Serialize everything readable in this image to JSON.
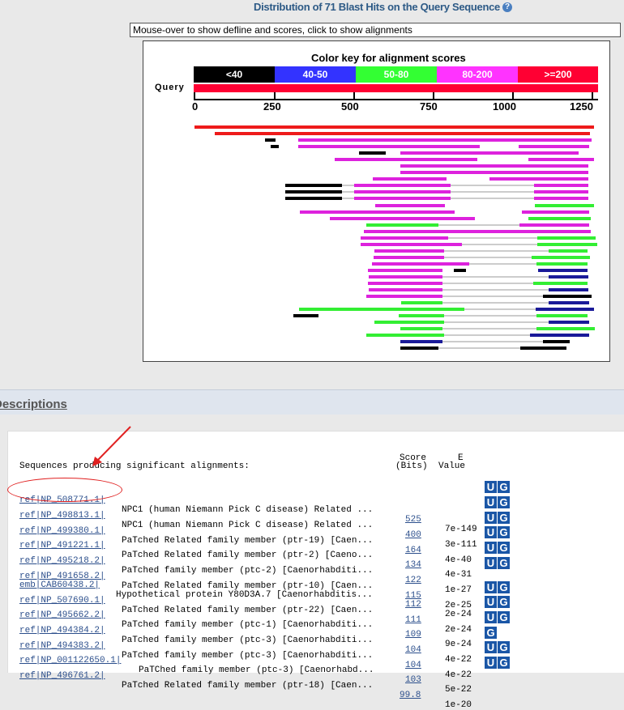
{
  "header": {
    "title": "Distribution of 71 Blast Hits on the Query Sequence",
    "help_icon": "help-icon"
  },
  "defline_box": {
    "text": "Mouse-over to show defline and scores, click to show alignments"
  },
  "color_key": {
    "title": "Color key for alignment scores",
    "cells": [
      {
        "label": "<40",
        "color": "#000000"
      },
      {
        "label": "40-50",
        "color": "#3333ff"
      },
      {
        "label": "50-80",
        "color": "#33ff33"
      },
      {
        "label": "80-200",
        "color": "#ff33ff"
      },
      {
        "label": ">=200",
        "color": "#ff0033"
      }
    ],
    "query_label": "Query",
    "axis_ticks": [
      "0",
      "250",
      "500",
      "750",
      "1000",
      "1250"
    ]
  },
  "hit_colors": {
    "red": "#ee1a1a",
    "pink": "#dd22dd",
    "green": "#33ee33",
    "blue": "#1a1a99",
    "black": "#000000"
  },
  "descriptions": {
    "section_title": "Descriptions",
    "seq_header": "Sequences producing significant alignments:",
    "score_header_1": "Score",
    "score_header_2": "(Bits)",
    "e_header_1": "E",
    "e_header_2": "Value",
    "rows": [
      {
        "acc": "ref|NP_508771.1|",
        "desc": "NPC1 (human Niemann Pick C disease) Related ...",
        "score": "525",
        "evalue": "7e-149",
        "ug": [
          "U",
          "G"
        ]
      },
      {
        "acc": "ref|NP_498813.1|",
        "desc": "NPC1 (human Niemann Pick C disease) Related ...",
        "score": "400",
        "evalue": "3e-111",
        "ug": [
          "U",
          "G"
        ]
      },
      {
        "acc": "ref|NP_499380.1|",
        "desc": "PaTched Related family member (ptr-19) [Caen...",
        "score": "164",
        "evalue": "4e-40",
        "ug": [
          "U",
          "G"
        ]
      },
      {
        "acc": "ref|NP_491221.1|",
        "desc": "PaTched Related family member (ptr-2) [Caeno...",
        "score": "134",
        "evalue": "4e-31",
        "ug": [
          "U",
          "G"
        ]
      },
      {
        "acc": "ref|NP_495218.2|",
        "desc": "PaTched family member (ptc-2) [Caenorhabditi...",
        "score": "122",
        "evalue": "1e-27",
        "ug": [
          "U",
          "G"
        ]
      },
      {
        "acc": "ref|NP_491658.2|",
        "desc": "PaTched Related family member (ptr-10) [Caen...",
        "score": "115",
        "evalue": "2e-25",
        "ug": [
          "U",
          "G"
        ]
      },
      {
        "acc": "emb|CAB60438.2|",
        "desc": "Hypothetical protein Y80D3A.7 [Caenorhabditis...",
        "score": "112",
        "evalue": "2e-24",
        "ug": []
      },
      {
        "acc": "ref|NP_507690.1|",
        "desc": "PaTched Related family member (ptr-22) [Caen...",
        "score": "111",
        "evalue": "2e-24",
        "ug": [
          "U",
          "G"
        ]
      },
      {
        "acc": "ref|NP_495662.2|",
        "desc": "PaTched family member (ptc-1) [Caenorhabditi...",
        "score": "109",
        "evalue": "9e-24",
        "ug": [
          "U",
          "G"
        ]
      },
      {
        "acc": "ref|NP_494384.2|",
        "desc": "PaTched family member (ptc-3) [Caenorhabditi...",
        "score": "104",
        "evalue": "4e-22",
        "ug": [
          "U",
          "G"
        ]
      },
      {
        "acc": "ref|NP_494383.2|",
        "desc": "PaTched family member (ptc-3) [Caenorhabditi...",
        "score": "104",
        "evalue": "4e-22",
        "ug": [
          "G"
        ]
      },
      {
        "acc": "ref|NP_001122650.1|",
        "desc": "PaTChed family member (ptc-3) [Caenorhabd...",
        "score": "103",
        "evalue": "5e-22",
        "ug": [
          "U",
          "G"
        ]
      },
      {
        "acc": "ref|NP_496761.2|",
        "desc": "PaTched Related family member (ptr-18) [Caen...",
        "score": "99.8",
        "evalue": "1e-20",
        "ug": [
          "U",
          "G"
        ]
      }
    ]
  }
}
